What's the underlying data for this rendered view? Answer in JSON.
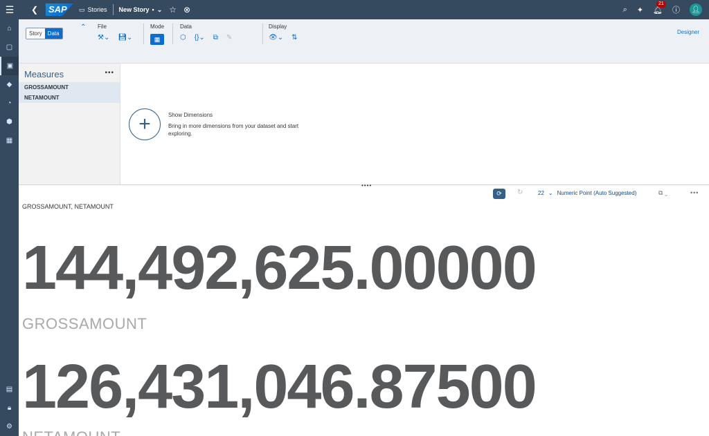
{
  "shell": {
    "back_icon": "chevron-left-icon",
    "logo": "SAP",
    "stories_label": "Stories",
    "story_title": "New Story",
    "story_dirty_mark": "•",
    "notification_count": "21"
  },
  "toolbar": {
    "story_tab": "Story",
    "data_tab": "Data",
    "file_label": "File",
    "mode_label": "Mode",
    "data_label": "Data",
    "display_label": "Display",
    "designer_label": "Designer"
  },
  "measures": {
    "title": "Measures",
    "items": [
      "GROSSAMOUNT",
      "NETAMOUNT"
    ]
  },
  "dimensions": {
    "title": "Show Dimensions",
    "description": "Bring in more dimensions from your dataset and start exploring."
  },
  "chart_toolbar": {
    "chart_type": "Numeric Point (Auto Suggested)",
    "chart_type_icon_text": "22"
  },
  "chart": {
    "title": "GROSSAMOUNT, NETAMOUNT",
    "values": [
      {
        "value": "144,492,625.00000",
        "label": "GROSSAMOUNT"
      },
      {
        "value": "126,431,046.87500",
        "label": "NETAMOUNT"
      }
    ]
  },
  "colors": {
    "shell": "#354a5f",
    "accent": "#0a6ed1",
    "number": "#58595b",
    "label": "#a9a9a9"
  }
}
